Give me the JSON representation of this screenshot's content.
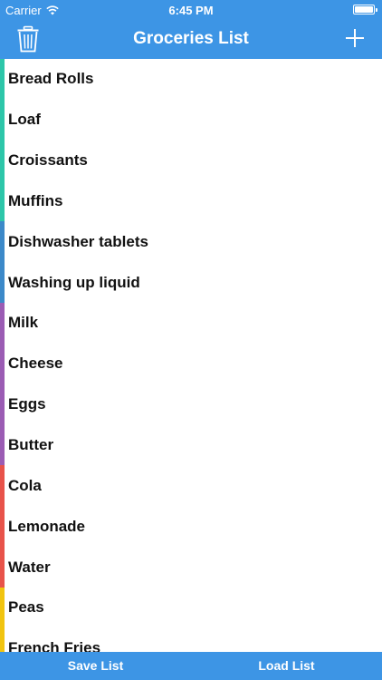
{
  "status_bar": {
    "carrier": "Carrier",
    "time": "6:45 PM",
    "icons": [
      "wifi-icon",
      "battery-icon"
    ]
  },
  "nav_bar": {
    "title": "Groceries List",
    "left_icon": "trash-icon",
    "right_icon": "plus-icon"
  },
  "colors": {
    "bar": "#3d95e5",
    "bakery": "#2dc6a9",
    "household": "#3c89c9",
    "dairy": "#9b5cb4",
    "drinks": "#e8534a",
    "frozen": "#f1c40f"
  },
  "items": [
    {
      "label": "Bread Rolls",
      "color": "#2dc6a9"
    },
    {
      "label": "Loaf",
      "color": "#2dc6a9"
    },
    {
      "label": "Croissants",
      "color": "#2dc6a9"
    },
    {
      "label": "Muffins",
      "color": "#2dc6a9"
    },
    {
      "label": "Dishwasher tablets",
      "color": "#3c89c9"
    },
    {
      "label": "Washing up liquid",
      "color": "#3c89c9"
    },
    {
      "label": "Milk",
      "color": "#9b5cb4"
    },
    {
      "label": "Cheese",
      "color": "#9b5cb4"
    },
    {
      "label": "Eggs",
      "color": "#9b5cb4"
    },
    {
      "label": "Butter",
      "color": "#9b5cb4"
    },
    {
      "label": "Cola",
      "color": "#e8534a"
    },
    {
      "label": "Lemonade",
      "color": "#e8534a"
    },
    {
      "label": "Water",
      "color": "#e8534a"
    },
    {
      "label": "Peas",
      "color": "#f1c40f"
    },
    {
      "label": "French Fries",
      "color": "#f1c40f"
    }
  ],
  "bottom_bar": {
    "save_label": "Save List",
    "load_label": "Load List"
  }
}
